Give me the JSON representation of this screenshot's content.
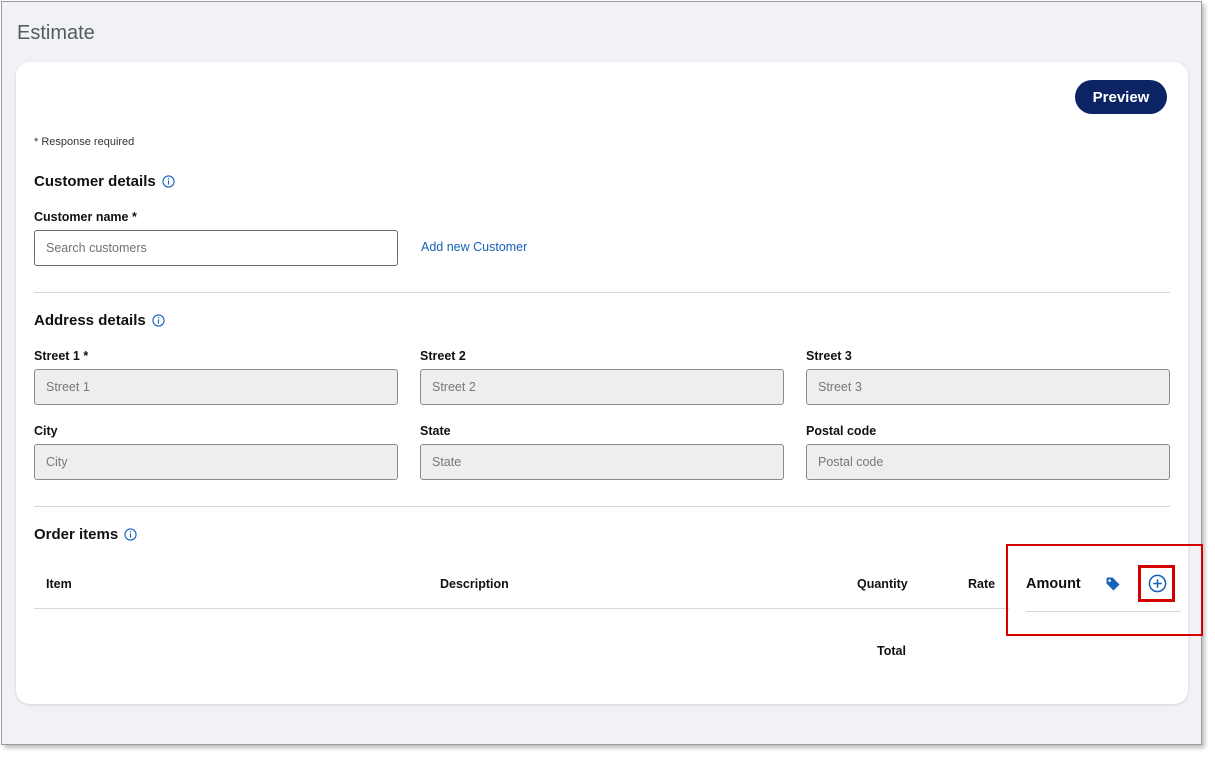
{
  "page": {
    "title": "Estimate"
  },
  "toolbar": {
    "preview_label": "Preview"
  },
  "form": {
    "required_note": "* Response required",
    "customer": {
      "section_title": "Customer details",
      "name_label": "Customer name *",
      "search_placeholder": "Search customers",
      "add_link": "Add new Customer"
    },
    "address": {
      "section_title": "Address details",
      "fields": [
        {
          "label": "Street 1 *",
          "placeholder": "Street 1"
        },
        {
          "label": "Street 2",
          "placeholder": "Street 2"
        },
        {
          "label": "Street 3",
          "placeholder": "Street 3"
        },
        {
          "label": "City",
          "placeholder": "City"
        },
        {
          "label": "State",
          "placeholder": "State"
        },
        {
          "label": "Postal code",
          "placeholder": "Postal code"
        }
      ]
    },
    "order": {
      "section_title": "Order items",
      "columns": {
        "item": "Item",
        "description": "Description",
        "quantity": "Quantity",
        "rate": "Rate",
        "amount": "Amount"
      },
      "total_label": "Total"
    }
  },
  "icons": {
    "info": "info-icon",
    "tag": "tag-icon",
    "add": "add-circle-icon"
  },
  "colors": {
    "primary": "#0d2464",
    "link": "#1662b8",
    "highlight": "#d40000"
  }
}
